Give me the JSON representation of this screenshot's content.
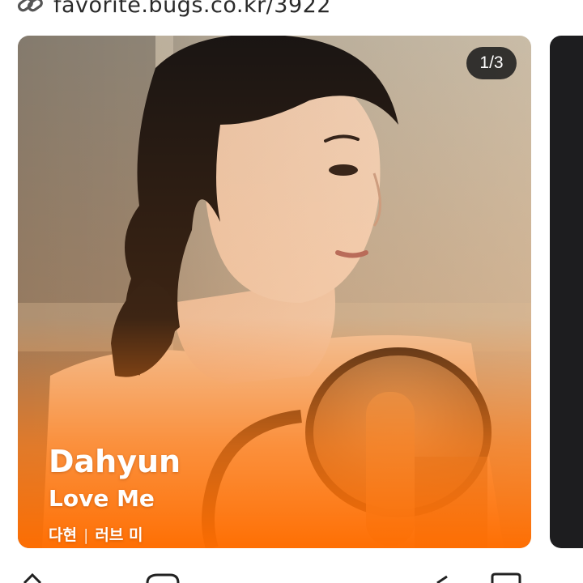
{
  "link": {
    "icon": "link-icon",
    "text": "favorite.bugs.co.kr/3922"
  },
  "card": {
    "counter": "1/3",
    "artist": "Dahyun",
    "song": "Love Me",
    "korean_artist": "다현",
    "separator": "|",
    "korean_song": "러브 미"
  },
  "colors": {
    "accent_orange": "#ff7a14",
    "counter_bg": "#1e1e1e",
    "next_card": "#1d1d1f"
  }
}
